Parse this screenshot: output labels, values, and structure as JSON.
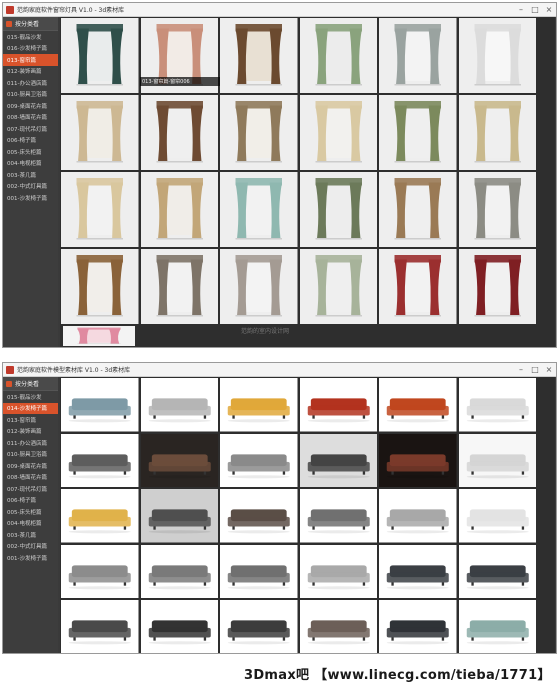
{
  "window1": {
    "title": "范韵家庭软件窗帘灯具 V1.0 - 3d素材库",
    "sidebar_header": "按分类看",
    "sidebar_items": [
      {
        "label": "015-靓品沙发",
        "active": false
      },
      {
        "label": "016-沙发椅子篇",
        "active": false
      },
      {
        "label": "013-窗帘篇",
        "active": true
      },
      {
        "label": "012-装饰画篇",
        "active": false
      },
      {
        "label": "011-办公酒店篇",
        "active": false
      },
      {
        "label": "010-厨具卫浴篇",
        "active": false
      },
      {
        "label": "009-桌面花卉篇",
        "active": false
      },
      {
        "label": "008-墙面花卉篇",
        "active": false
      },
      {
        "label": "007-现代吊灯篇",
        "active": false
      },
      {
        "label": "006-椅子篇",
        "active": false
      },
      {
        "label": "005-床头柜篇",
        "active": false
      },
      {
        "label": "004-电视柜篇",
        "active": false
      },
      {
        "label": "003-茶几篇",
        "active": false
      },
      {
        "label": "002-中式灯具篇",
        "active": false
      },
      {
        "label": "001-沙发椅子篇",
        "active": false
      }
    ],
    "hover_label": "013-窗帘篇-窗帘006",
    "watermark": "范韵的室内设计网"
  },
  "window2": {
    "title": "范韵家庭软件模型素材库 V1.0 - 3d素材库",
    "sidebar_header": "按分类看",
    "sidebar_items": [
      {
        "label": "015-靓品沙发",
        "active": false
      },
      {
        "label": "014-沙发椅子篇",
        "active": true
      },
      {
        "label": "013-窗帘篇",
        "active": false
      },
      {
        "label": "012-装饰画篇",
        "active": false
      },
      {
        "label": "011-办公酒店篇",
        "active": false
      },
      {
        "label": "010-厨具卫浴篇",
        "active": false
      },
      {
        "label": "009-桌面花卉篇",
        "active": false
      },
      {
        "label": "008-墙面花卉篇",
        "active": false
      },
      {
        "label": "007-现代吊灯篇",
        "active": false
      },
      {
        "label": "006-椅子篇",
        "active": false
      },
      {
        "label": "005-床头柜篇",
        "active": false
      },
      {
        "label": "004-电视柜篇",
        "active": false
      },
      {
        "label": "003-茶几篇",
        "active": false
      },
      {
        "label": "002-中式灯具篇",
        "active": false
      },
      {
        "label": "001-沙发椅子篇",
        "active": false
      }
    ]
  },
  "credit": "3Dmax吧 【www.linecg.com/tieba/1771】",
  "colors": {
    "accent": "#d9532b",
    "sidebar_bg": "#3d3d3d",
    "grid_bg": "#2e2e2e"
  }
}
